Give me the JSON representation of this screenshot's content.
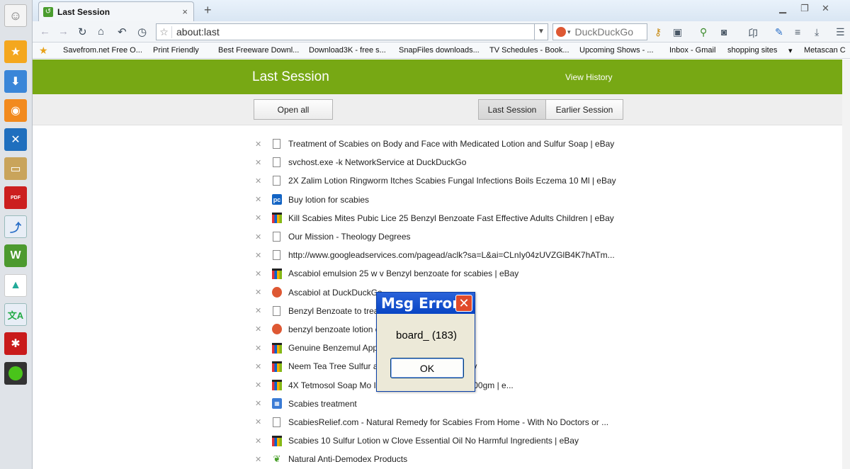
{
  "window": {
    "tab_title": "Last Session",
    "new_tab": "+",
    "close_tab": "×"
  },
  "toolbar": {
    "url": "about:last",
    "search_placeholder": "DuckDuckGo"
  },
  "bookmarks": [
    "Savefrom.net Free O...",
    "Print Friendly",
    "Best Freeware Downl...",
    "Download3K - free s...",
    "SnapFiles downloads...",
    "TV Schedules - Book...",
    "Upcoming Shows - ...",
    "Inbox - Gmail",
    "shopping sites",
    "Metascan C"
  ],
  "page": {
    "title": "Last Session",
    "view_history": "View History",
    "open_all": "Open all",
    "last_session_tab": "Last Session",
    "earlier_session_tab": "Earlier Session"
  },
  "sessions": [
    {
      "icon": "doc",
      "title": "Treatment of Scabies on Body and Face with Medicated Lotion and Sulfur Soap | eBay"
    },
    {
      "icon": "doc",
      "title": "svchost.exe -k NetworkService at DuckDuckGo"
    },
    {
      "icon": "doc",
      "title": "2X Zalim Lotion Ringworm Itches Scabies Fungal Infections Boils Eczema 10 Ml | eBay"
    },
    {
      "icon": "pc",
      "title": "Buy lotion for scabies"
    },
    {
      "icon": "ebay",
      "title": "Kill Scabies Mites Pubic Lice 25 Benzyl Benzoate Fast Effective Adults Children | eBay"
    },
    {
      "icon": "doc",
      "title": "Our Mission - Theology Degrees"
    },
    {
      "icon": "doc",
      "title": "http://www.googleadservices.com/pagead/aclk?sa=L&ai=CLnIy04zUVZGlB4K7hATm..."
    },
    {
      "icon": "ebay",
      "title": "Ascabiol emulsion 25 w v Benzyl benzoate for scabies | eBay"
    },
    {
      "icon": "ddg",
      "title": "Ascabiol at DuckDuckGo"
    },
    {
      "icon": "doc",
      "title": "Benzyl Benzoate to trea"
    },
    {
      "icon": "ddg",
      "title": "benzyl benzoate lotion                                  o"
    },
    {
      "icon": "ebay",
      "title": "Genuine Benzemul App"
    },
    {
      "icon": "ebay",
      "title": "Neem Tea Tree Sulfur                                  atural 5 oz Bar Soap | eBay"
    },
    {
      "icon": "ebay",
      "title": "4X Tetmosol Soap Mo                                  Infection Eczema Itching 100gm | e..."
    },
    {
      "icon": "img",
      "title": "Scabies treatment"
    },
    {
      "icon": "doc",
      "title": "ScabiesRelief.com - Natural Remedy for Scabies From Home - With No Doctors or ..."
    },
    {
      "icon": "ebay",
      "title": "Scabies 10 Sulfur Lotion w Clove Essential Oil No Harmful Ingredients | eBay"
    },
    {
      "icon": "leaf",
      "title": "Natural Anti-Demodex Products"
    }
  ],
  "dialog": {
    "title": "Msg Error",
    "message": "board_ (183)",
    "ok": "OK"
  }
}
